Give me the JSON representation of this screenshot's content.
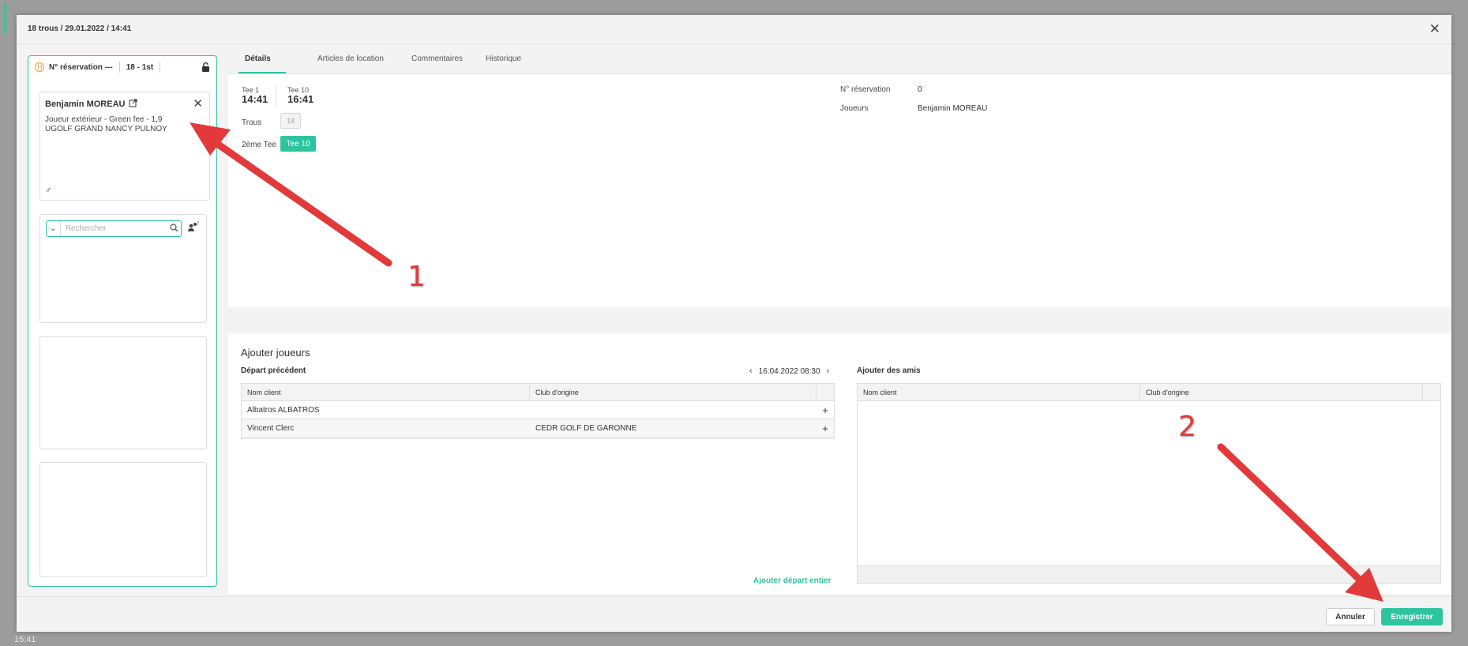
{
  "background": {
    "time_label": "15:41"
  },
  "modal": {
    "title": "18 trous / 29.01.2022 / 14:41",
    "close_glyph": "✕"
  },
  "left_panel": {
    "reservation_label": "N° réservation ---",
    "holes_label": "18 - 1st",
    "player": {
      "name": "Benjamin MOREAU",
      "info_line1": "Joueur extérieur - Green fee - 1,9",
      "info_line2": "UGOLF GRAND NANCY PULNOY",
      "gender_glyph": "♂"
    },
    "search": {
      "placeholder": "Rechercher"
    }
  },
  "tabs": [
    {
      "label": "Détails",
      "active": true
    },
    {
      "label": "Articles de location",
      "active": false
    },
    {
      "label": "Commentaires",
      "active": false
    },
    {
      "label": "Historique",
      "active": false
    }
  ],
  "details": {
    "tee1_label": "Tee 1",
    "tee1_time": "14:41",
    "tee10_label": "Tee 10",
    "tee10_time": "16:41",
    "trous_label": "Trous",
    "trous_value": "18",
    "second_tee_label": "2ème Tee",
    "second_tee_value": "Tee 10",
    "reservation_label": "N° réservation",
    "reservation_value": "0",
    "players_label": "Joueurs",
    "players_value": "Benjamin MOREAU"
  },
  "add_players": {
    "title": "Ajouter joueurs",
    "previous_title": "Départ précédent",
    "date_value": "16.04.2022 08:30",
    "columns": [
      "Nom client",
      "Club d'origine"
    ],
    "rows": [
      {
        "name": "Albatros ALBATROS",
        "club": ""
      },
      {
        "name": "Vincent Clerc",
        "club": "CEDR GOLF DE GARONNE"
      }
    ],
    "add_whole_label": "Ajouter départ entier",
    "friends_title": "Ajouter des amis",
    "friends_columns": [
      "Nom client",
      "Club d'origine"
    ]
  },
  "footer": {
    "cancel_label": "Annuler",
    "save_label": "Enregistrer"
  },
  "annotations": {
    "label1": "1",
    "label2": "2",
    "color": "#e23a3a"
  },
  "colors": {
    "accent": "#2ec4a0",
    "globe": "#e9a23b"
  }
}
